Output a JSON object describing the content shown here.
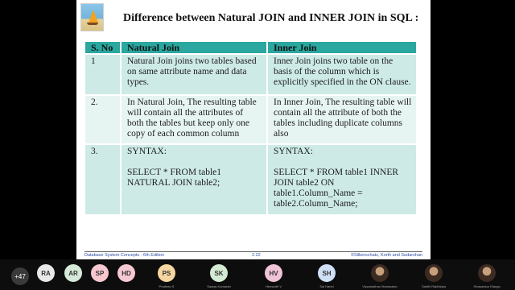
{
  "slide": {
    "title": "Difference between Natural JOIN and INNER JOIN in SQL :",
    "table": {
      "headers": [
        "S. No",
        "Natural Join",
        "Inner Join"
      ],
      "rows": [
        [
          "1",
          "Natural Join joins two tables based\non same attribute name and data\ntypes.",
          "Inner Join joins two table on the\nbasis of the column which is\nexplicitly specified in the ON clause."
        ],
        [
          "2.",
          "In Natural Join, The resulting table\nwill contain all the attributes of\nboth the tables but keep only one\ncopy of each common column",
          "In Inner Join, The resulting table will\ncontain all the attribute of both the\ntables including duplicate columns\nalso"
        ],
        [
          "3.",
          "SYNTAX:\n\nSELECT * FROM table1\nNATURAL JOIN table2;",
          "SYNTAX:\n\nSELECT * FROM table1 INNER\nJOIN table2 ON\ntable1.Column_Name =\ntable2.Column_Name;"
        ]
      ]
    },
    "footer": {
      "left": "Database System Concepts - 6th Edition",
      "center": "2.22",
      "right": "©Silberschatz, Korth and Sudarshan"
    }
  },
  "participants": {
    "overflow_count": "+47",
    "people": [
      {
        "initials": "RA",
        "name": "",
        "color": "#e8e8e8"
      },
      {
        "initials": "AR",
        "name": "",
        "color": "#d6ead9"
      },
      {
        "initials": "SP",
        "name": "",
        "color": "#f6c7cf"
      },
      {
        "initials": "HD",
        "name": "",
        "color": "#f4c9d4"
      },
      {
        "initials": "PS",
        "name": "Pradeep S",
        "color": "#f7d7a1"
      },
      {
        "initials": "SK",
        "name": "Sanjay Kumaran",
        "color": "#d3ead4"
      },
      {
        "initials": "HV",
        "name": "Hemanth V",
        "color": "#efc3d8"
      },
      {
        "initials": "SH",
        "name": "Sai Harini",
        "color": "#cfe0f5"
      },
      {
        "initials": "",
        "name": "Viswanathan Manavalan",
        "color": ""
      },
      {
        "initials": "",
        "name": "Sakthi Rakthidya",
        "color": ""
      },
      {
        "initials": "",
        "name": "Sivasankar Elango",
        "color": ""
      }
    ]
  }
}
